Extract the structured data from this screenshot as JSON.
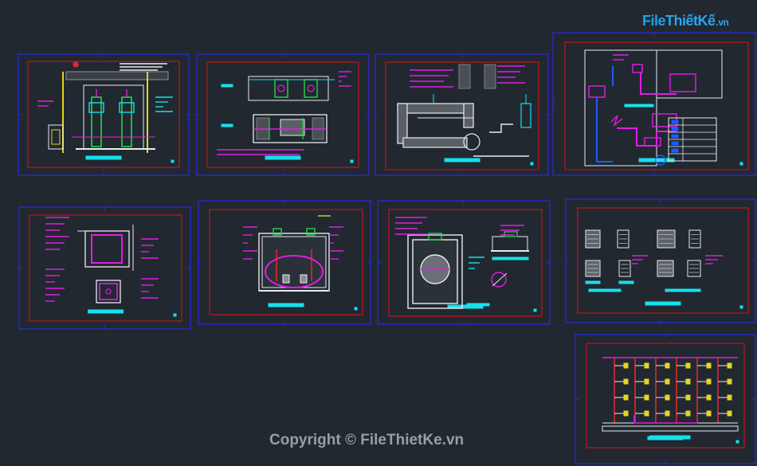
{
  "watermark": {
    "logo_file": "File",
    "logo_rest": "ThiếtKế",
    "logo_vn": ".vn",
    "copyright": "Copyright © FileThietKe.vn"
  },
  "colors": {
    "background": "#212830",
    "sheet_border": "#2a2ad8",
    "inner_frame": "#c0141e",
    "cyan": "#16e0ec",
    "magenta": "#e21ce6",
    "green": "#22d84a",
    "blue": "#1f5bff",
    "white": "#e8ecef",
    "yellow": "#e4d623",
    "red": "#e3262d",
    "gray": "#8c9298"
  },
  "sheets": [
    {
      "name": "sheet-1-pump-station-section"
    },
    {
      "name": "sheet-2-tank-plan-and-section"
    },
    {
      "name": "sheet-3-pipe-detail"
    },
    {
      "name": "sheet-4-piping-schematic"
    },
    {
      "name": "sheet-5-pit-plan"
    },
    {
      "name": "sheet-6-tank-cross-section"
    },
    {
      "name": "sheet-7-manhole-section"
    },
    {
      "name": "sheet-8-equipment-details"
    },
    {
      "name": "sheet-9-riser-diagram"
    }
  ]
}
